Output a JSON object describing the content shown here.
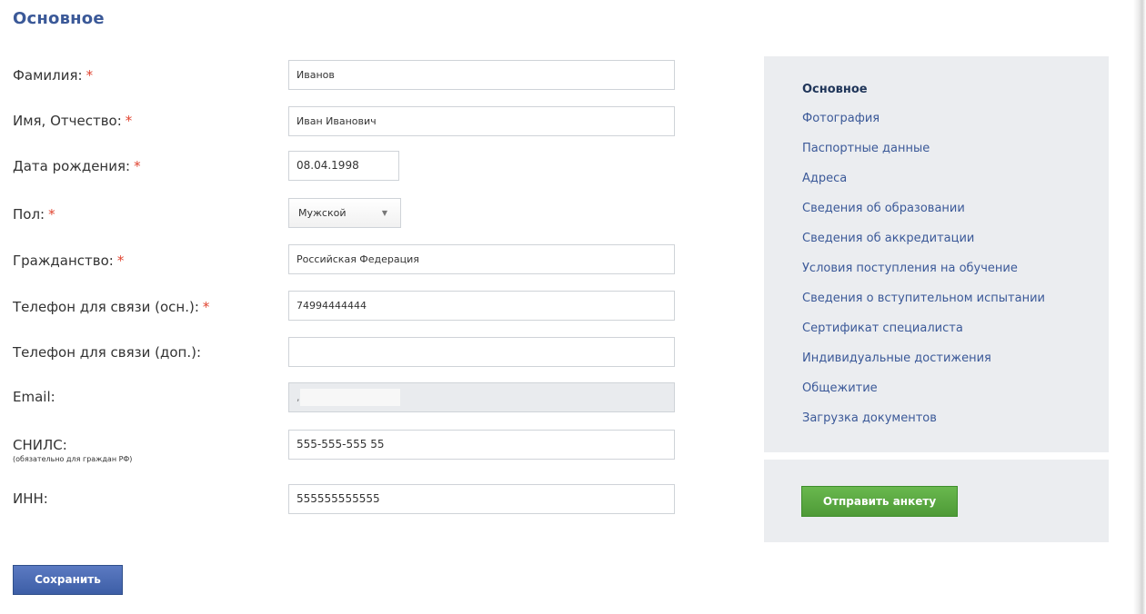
{
  "section_title": "Основное",
  "required_mark": "*",
  "form": {
    "last_name": {
      "label": "Фамилия:",
      "value": "Иванов"
    },
    "first_middle_name": {
      "label": "Имя, Отчество:",
      "value": "Иван Иванович"
    },
    "birth_date": {
      "label": "Дата рождения:",
      "value": "08.04.1998"
    },
    "gender": {
      "label": "Пол:",
      "value": "Мужской"
    },
    "citizenship": {
      "label": "Гражданство:",
      "value": "Российская Федерация"
    },
    "phone_main": {
      "label": "Телефон для связи (осн.):",
      "value": "74994444444"
    },
    "phone_extra": {
      "label": "Телефон для связи (доп.):",
      "value": ""
    },
    "email": {
      "label": "Email:",
      "value": ","
    },
    "snils": {
      "label": "СНИЛС:",
      "note": "(обязательно для граждан РФ)",
      "value": "555-555-555 55"
    },
    "inn": {
      "label": "ИНН:",
      "value": "555555555555"
    }
  },
  "save_button": "Сохранить",
  "nav": {
    "items": [
      {
        "label": "Основное",
        "active": true
      },
      {
        "label": "Фотография"
      },
      {
        "label": "Паспортные данные"
      },
      {
        "label": "Адреса"
      },
      {
        "label": "Сведения об образовании"
      },
      {
        "label": "Сведения об аккредитации"
      },
      {
        "label": "Условия поступления на обучение"
      },
      {
        "label": "Сведения о вступительном испытании"
      },
      {
        "label": "Сертификат специалиста"
      },
      {
        "label": "Индивидуальные достижения"
      },
      {
        "label": "Общежитие"
      },
      {
        "label": "Загрузка документов"
      }
    ]
  },
  "submit_button": "Отправить анкету",
  "icons": {
    "gender_dropdown": "triangle-down-icon"
  },
  "colors": {
    "title": "#3b5998",
    "link": "#3b5998",
    "required": "#e0432f",
    "panel": "#ebedf0",
    "save_button": "#4565ad",
    "submit_button": "#5aa842"
  }
}
